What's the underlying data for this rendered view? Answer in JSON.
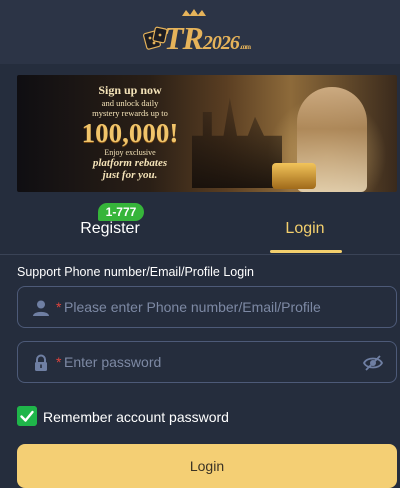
{
  "header": {
    "logo": {
      "text_tr": "TR",
      "text_num": "2026",
      "text_com": ".com",
      "icon": "casino-dice-crown-logo"
    }
  },
  "banner": {
    "line1": "Sign up now",
    "line2": "and unlock daily",
    "line3": "mystery rewards up to",
    "big_number": "100,000!",
    "line4": "Enjoy exclusive",
    "line5": "platform rebates",
    "line6": "just for you."
  },
  "tabs": [
    {
      "label": "Register",
      "badge": "1-777",
      "active": false
    },
    {
      "label": "Login",
      "active": true
    }
  ],
  "form": {
    "title": "Support Phone number/Email/Profile Login",
    "phone": {
      "placeholder": "Please enter Phone number/Email/Profile",
      "value": "",
      "required_mark": "*",
      "icon": "user-icon"
    },
    "password": {
      "placeholder": "Enter password",
      "value": "",
      "required_mark": "*",
      "icon": "lock-icon",
      "toggle_icon": "eye-off-icon"
    },
    "remember": {
      "label": "Remember account password",
      "checked": true
    },
    "submit_label": "Login"
  },
  "colors": {
    "background": "#2a3244",
    "accent": "#f3cf6d",
    "badge": "#36b53a",
    "checkbox": "#1fb54a",
    "required": "#e0443c"
  }
}
